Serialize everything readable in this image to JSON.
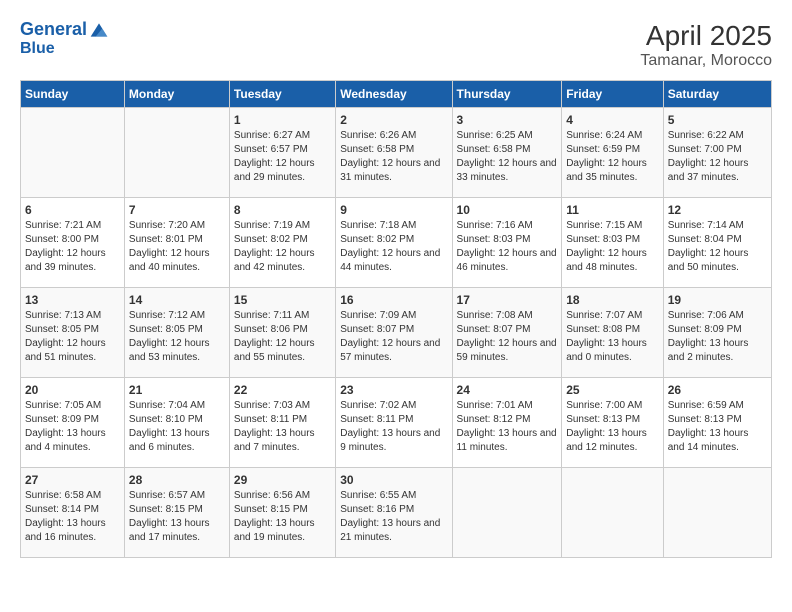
{
  "logo": {
    "line1": "General",
    "line2": "Blue"
  },
  "title": "April 2025",
  "subtitle": "Tamanar, Morocco",
  "weekdays": [
    "Sunday",
    "Monday",
    "Tuesday",
    "Wednesday",
    "Thursday",
    "Friday",
    "Saturday"
  ],
  "weeks": [
    [
      {
        "day": "",
        "info": ""
      },
      {
        "day": "",
        "info": ""
      },
      {
        "day": "1",
        "info": "Sunrise: 6:27 AM\nSunset: 6:57 PM\nDaylight: 12 hours and 29 minutes."
      },
      {
        "day": "2",
        "info": "Sunrise: 6:26 AM\nSunset: 6:58 PM\nDaylight: 12 hours and 31 minutes."
      },
      {
        "day": "3",
        "info": "Sunrise: 6:25 AM\nSunset: 6:58 PM\nDaylight: 12 hours and 33 minutes."
      },
      {
        "day": "4",
        "info": "Sunrise: 6:24 AM\nSunset: 6:59 PM\nDaylight: 12 hours and 35 minutes."
      },
      {
        "day": "5",
        "info": "Sunrise: 6:22 AM\nSunset: 7:00 PM\nDaylight: 12 hours and 37 minutes."
      }
    ],
    [
      {
        "day": "6",
        "info": "Sunrise: 7:21 AM\nSunset: 8:00 PM\nDaylight: 12 hours and 39 minutes."
      },
      {
        "day": "7",
        "info": "Sunrise: 7:20 AM\nSunset: 8:01 PM\nDaylight: 12 hours and 40 minutes."
      },
      {
        "day": "8",
        "info": "Sunrise: 7:19 AM\nSunset: 8:02 PM\nDaylight: 12 hours and 42 minutes."
      },
      {
        "day": "9",
        "info": "Sunrise: 7:18 AM\nSunset: 8:02 PM\nDaylight: 12 hours and 44 minutes."
      },
      {
        "day": "10",
        "info": "Sunrise: 7:16 AM\nSunset: 8:03 PM\nDaylight: 12 hours and 46 minutes."
      },
      {
        "day": "11",
        "info": "Sunrise: 7:15 AM\nSunset: 8:03 PM\nDaylight: 12 hours and 48 minutes."
      },
      {
        "day": "12",
        "info": "Sunrise: 7:14 AM\nSunset: 8:04 PM\nDaylight: 12 hours and 50 minutes."
      }
    ],
    [
      {
        "day": "13",
        "info": "Sunrise: 7:13 AM\nSunset: 8:05 PM\nDaylight: 12 hours and 51 minutes."
      },
      {
        "day": "14",
        "info": "Sunrise: 7:12 AM\nSunset: 8:05 PM\nDaylight: 12 hours and 53 minutes."
      },
      {
        "day": "15",
        "info": "Sunrise: 7:11 AM\nSunset: 8:06 PM\nDaylight: 12 hours and 55 minutes."
      },
      {
        "day": "16",
        "info": "Sunrise: 7:09 AM\nSunset: 8:07 PM\nDaylight: 12 hours and 57 minutes."
      },
      {
        "day": "17",
        "info": "Sunrise: 7:08 AM\nSunset: 8:07 PM\nDaylight: 12 hours and 59 minutes."
      },
      {
        "day": "18",
        "info": "Sunrise: 7:07 AM\nSunset: 8:08 PM\nDaylight: 13 hours and 0 minutes."
      },
      {
        "day": "19",
        "info": "Sunrise: 7:06 AM\nSunset: 8:09 PM\nDaylight: 13 hours and 2 minutes."
      }
    ],
    [
      {
        "day": "20",
        "info": "Sunrise: 7:05 AM\nSunset: 8:09 PM\nDaylight: 13 hours and 4 minutes."
      },
      {
        "day": "21",
        "info": "Sunrise: 7:04 AM\nSunset: 8:10 PM\nDaylight: 13 hours and 6 minutes."
      },
      {
        "day": "22",
        "info": "Sunrise: 7:03 AM\nSunset: 8:11 PM\nDaylight: 13 hours and 7 minutes."
      },
      {
        "day": "23",
        "info": "Sunrise: 7:02 AM\nSunset: 8:11 PM\nDaylight: 13 hours and 9 minutes."
      },
      {
        "day": "24",
        "info": "Sunrise: 7:01 AM\nSunset: 8:12 PM\nDaylight: 13 hours and 11 minutes."
      },
      {
        "day": "25",
        "info": "Sunrise: 7:00 AM\nSunset: 8:13 PM\nDaylight: 13 hours and 12 minutes."
      },
      {
        "day": "26",
        "info": "Sunrise: 6:59 AM\nSunset: 8:13 PM\nDaylight: 13 hours and 14 minutes."
      }
    ],
    [
      {
        "day": "27",
        "info": "Sunrise: 6:58 AM\nSunset: 8:14 PM\nDaylight: 13 hours and 16 minutes."
      },
      {
        "day": "28",
        "info": "Sunrise: 6:57 AM\nSunset: 8:15 PM\nDaylight: 13 hours and 17 minutes."
      },
      {
        "day": "29",
        "info": "Sunrise: 6:56 AM\nSunset: 8:15 PM\nDaylight: 13 hours and 19 minutes."
      },
      {
        "day": "30",
        "info": "Sunrise: 6:55 AM\nSunset: 8:16 PM\nDaylight: 13 hours and 21 minutes."
      },
      {
        "day": "",
        "info": ""
      },
      {
        "day": "",
        "info": ""
      },
      {
        "day": "",
        "info": ""
      }
    ]
  ]
}
